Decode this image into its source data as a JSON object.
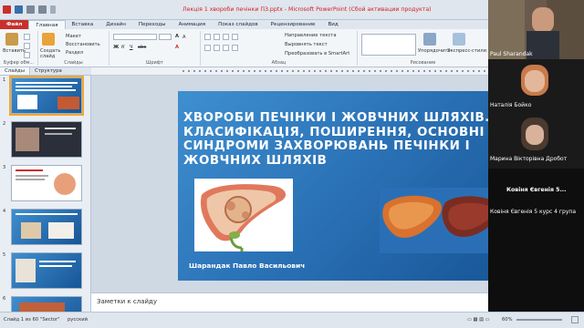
{
  "window": {
    "title": "Лекція 1 хвороби печінки ПЗ.pptx - Microsoft PowerPoint (Сбой активации продукта)",
    "colors": {
      "accent": "#c9302c",
      "slide_blue": "#2c74b8",
      "title_red": "#d42020"
    }
  },
  "ribbon": {
    "tabs": [
      "Файл",
      "Главная",
      "Вставка",
      "Дизайн",
      "Переходы",
      "Анимация",
      "Показ слайдов",
      "Рецензирование",
      "Вид"
    ],
    "active_tab": "Главная",
    "clipboard": {
      "paste": "Вставить",
      "group": "Буфер обм..."
    },
    "slides_group": {
      "new_slide": "Создать слайд",
      "layout": "Макет",
      "reset": "Восстановить",
      "section": "Раздел",
      "group": "Слайды"
    },
    "font_group": {
      "group": "Шрифт"
    },
    "paragraph_group": {
      "group": "Абзац",
      "text_direction": "Направление текста",
      "align_text": "Выровнять текст",
      "smartart": "Преобразовать в SmartArt"
    },
    "drawing_group": {
      "arrange": "Упорядочить",
      "quick_styles": "Экспресс-стили",
      "group": "Рисование"
    }
  },
  "left_panel": {
    "tabs": [
      "Слайды",
      "Структура"
    ],
    "active_tab": "Слайды",
    "thumbnails": [
      {
        "number": "1",
        "selected": true
      },
      {
        "number": "2",
        "selected": false
      },
      {
        "number": "3",
        "selected": false
      },
      {
        "number": "4",
        "selected": false
      },
      {
        "number": "5",
        "selected": false
      },
      {
        "number": "6",
        "selected": false
      }
    ]
  },
  "slide": {
    "title": "ХВОРОБИ ПЕЧІНКИ І ЖОВЧНИХ ШЛЯХІВ.\nКЛАСИФІКАЦІЯ, ПОШИРЕННЯ, ОСНОВНІ\nСИНДРОМИ ЗАХВОРЮВАНЬ ПЕЧІНКИ І\nЖОВЧНИХ ШЛЯХІВ",
    "author": "Шарандак Павло Васильович"
  },
  "notes": {
    "placeholder": "Заметки к слайду"
  },
  "status_bar": {
    "slide_info": "Слайд 1 из 60",
    "theme": "\"Sector\"",
    "language": "русский",
    "zoom": "60%"
  },
  "participants": [
    {
      "name": "Paul Sharandak",
      "label": "Paul Sharandak"
    },
    {
      "name": "Наталія Бойко",
      "label": "Наталія Бойко"
    },
    {
      "name": "Марина Вікторівна Дробот",
      "label": "Марина Вікторівна Дробот"
    },
    {
      "name": "Ковіня Євгенія 5...",
      "label": "Ковіня Євгенія 5 курс 4 група"
    }
  ]
}
